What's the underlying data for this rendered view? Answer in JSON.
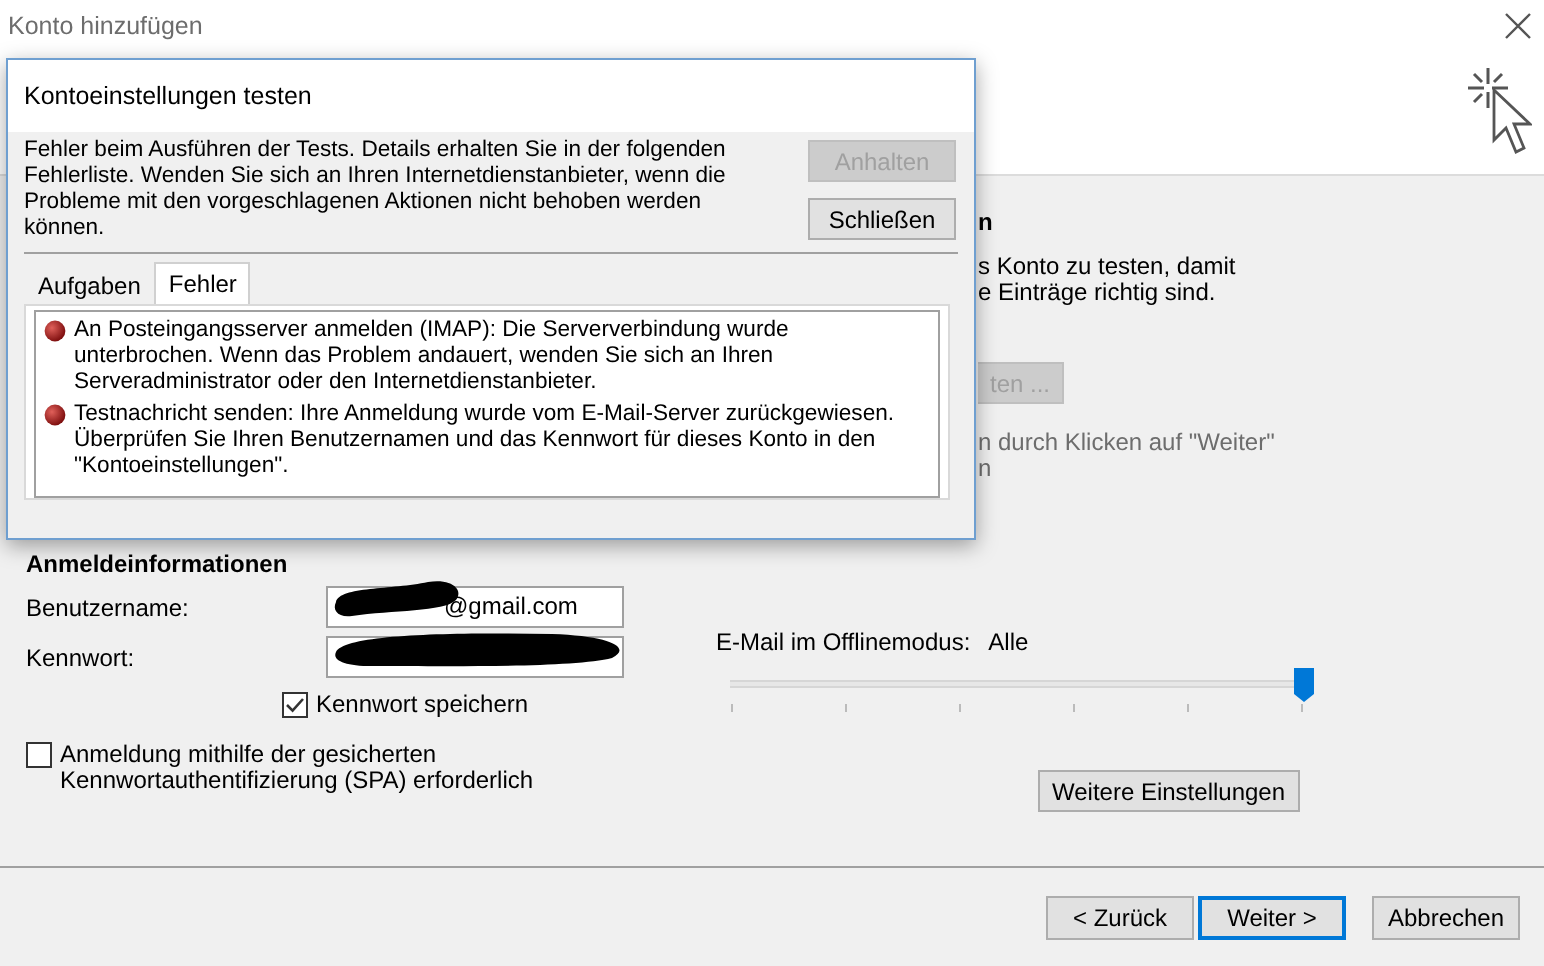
{
  "window": {
    "title": "Konto hinzufügen"
  },
  "background": {
    "heading_fragment": "n",
    "description_fragments": [
      "s Konto zu testen, damit",
      "e Einträge richtig sind."
    ],
    "test_button": {
      "label": "ten ...",
      "disabled": true
    },
    "hint_fragments": [
      "n durch Klicken auf \"Weiter\"",
      "n"
    ]
  },
  "logon": {
    "heading": "Anmeldeinformationen",
    "fields": [
      {
        "label": "Benutzername:",
        "value": "@gmail.com",
        "redacted": true
      },
      {
        "label": "Kennwort:",
        "redacted": true
      }
    ],
    "remember_password": {
      "label": "Kennwort speichern",
      "checked": true
    },
    "spa": {
      "label": "Anmeldung mithilfe der gesicherten Kennwortauthentifizierung (SPA) erforderlich",
      "checked": false
    }
  },
  "offline": {
    "label": "E-Mail im Offlinemodus:",
    "value": "Alle",
    "level": 1
  },
  "more_settings_button": "Weitere Einstellungen",
  "nav_buttons": [
    {
      "label": "< Zurück",
      "focused": false
    },
    {
      "label": "Weiter >",
      "focused": true
    },
    {
      "label": "Abbrechen",
      "focused": false
    }
  ],
  "test_dialog": {
    "title": "Kontoeinstellungen testen",
    "message": "Fehler beim Ausführen der Tests. Details erhalten Sie in der folgenden Fehlerliste. Wenden Sie sich an Ihren Internetdienstanbieter, wenn die Probleme mit den vorgeschlagenen Aktionen nicht behoben werden können.",
    "buttons": [
      {
        "label": "Anhalten",
        "disabled": true
      },
      {
        "label": "Schließen",
        "disabled": false
      }
    ],
    "tabs": [
      {
        "label": "Aufgaben",
        "selected": false
      },
      {
        "label": "Fehler",
        "selected": true
      }
    ],
    "errors": [
      "An Posteingangsserver anmelden (IMAP): Die Serververbindung wurde unterbrochen. Wenn das Problem andauert, wenden Sie sich an Ihren Serveradministrator oder den Internetdienstanbieter.",
      "Testnachricht senden: Ihre Anmeldung wurde vom E-Mail-Server zurückgewiesen. Überprüfen Sie Ihren Benutzernamen und das Kennwort für dieses Konto in den \"Kontoeinstellungen\"."
    ]
  }
}
